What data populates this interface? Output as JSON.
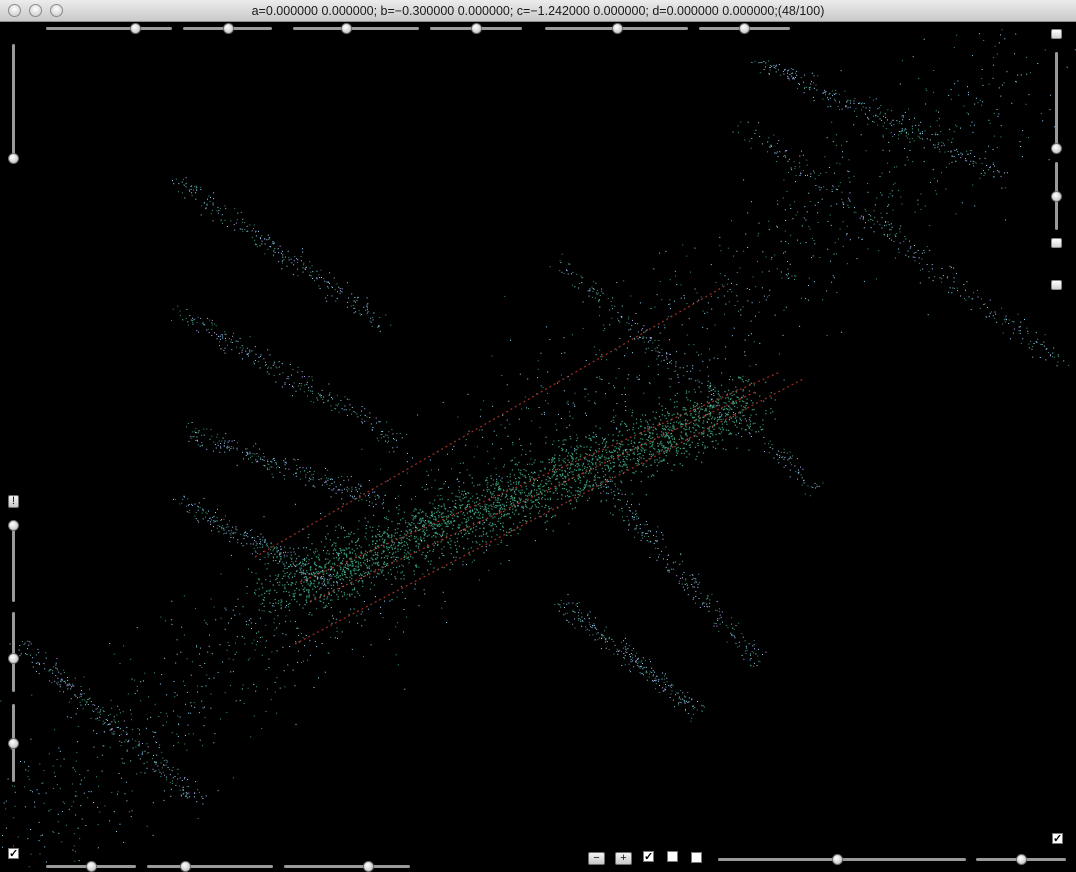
{
  "window": {
    "title": "a=0.000000 0.000000; b=−0.300000 0.000000; c=−1.242000 0.000000; d=0.000000 0.000000;(48/100)"
  },
  "controls": {
    "info_button_label": "!",
    "minus_label": "−",
    "plus_label": "+",
    "check_mark": "✓",
    "checkboxes": {
      "bottom_left": true,
      "bottom_1": true,
      "bottom_2": false,
      "bottom_3": false,
      "bottom_right": true
    }
  },
  "colors": {
    "background": "#000000",
    "fractal_green": "#3aa07a",
    "fractal_cyan": "#8fd6ff",
    "fractal_violet": "#c8a6ff",
    "highlight_red": "#b8332a"
  }
}
